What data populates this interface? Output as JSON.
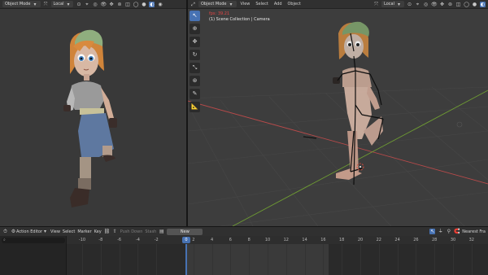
{
  "left_header": {
    "mode": "Object Mode",
    "orientation": "Local"
  },
  "right_header": {
    "mode": "Object Mode",
    "menus": [
      "View",
      "Select",
      "Add",
      "Object"
    ],
    "orientation": "Local"
  },
  "viewport": {
    "fps": "fps: 39.21",
    "collection": "(1) Scene Collection | Camera"
  },
  "tools": [
    "select-box",
    "cursor",
    "move",
    "rotate",
    "scale",
    "transform",
    "annotate",
    "measure"
  ],
  "timeline": {
    "editor": "Action Editor",
    "menus": [
      "View",
      "Select",
      "Marker",
      "Key"
    ],
    "push_down": "Push Down",
    "stash": "Stash",
    "new_action": "New",
    "interpolation": "Nearest Fra",
    "current_frame": "0",
    "ticks": [
      "-10",
      "-8",
      "-6",
      "-4",
      "-2",
      "0",
      "2",
      "4",
      "6",
      "8",
      "10",
      "12",
      "14",
      "16",
      "18",
      "20",
      "22",
      "24",
      "26",
      "28",
      "30",
      "32"
    ]
  },
  "colors": {
    "accent": "#4772b3",
    "fps_text": "#e04646",
    "x_axis": "#b84a4a",
    "y_axis": "#6e9b33"
  }
}
